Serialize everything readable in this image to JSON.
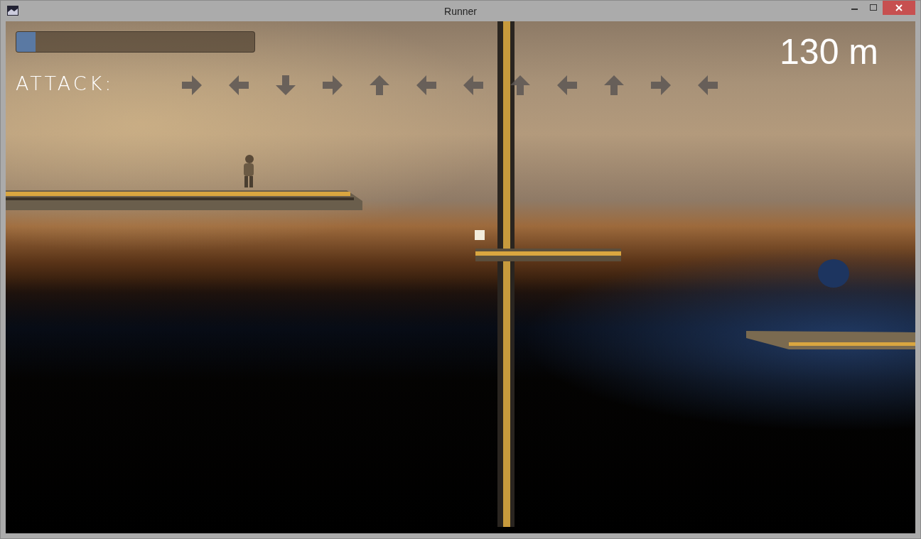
{
  "window": {
    "title": "Runner"
  },
  "hud": {
    "progress": {
      "level": 0.08
    },
    "attack_label": "ATTACK:",
    "distance": "130 m",
    "arrows": [
      {
        "kind": "right"
      },
      {
        "kind": "left"
      },
      {
        "kind": "down"
      },
      {
        "kind": "right"
      },
      {
        "kind": "up"
      },
      {
        "kind": "left"
      },
      {
        "kind": "left"
      },
      {
        "kind": "up"
      },
      {
        "kind": "left"
      },
      {
        "kind": "up"
      },
      {
        "kind": "right"
      },
      {
        "kind": "left"
      }
    ]
  }
}
